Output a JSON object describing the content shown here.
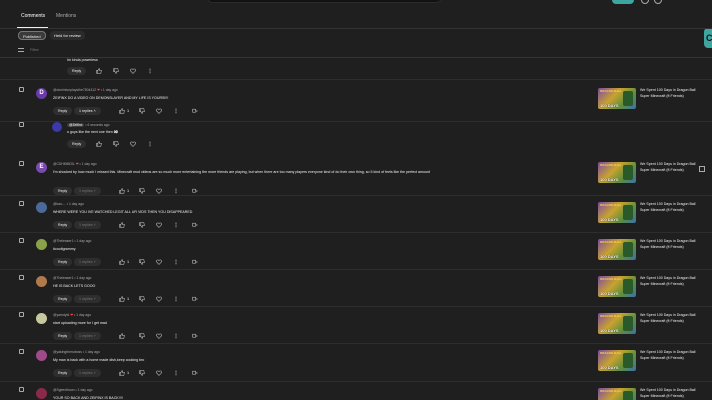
{
  "tabs": [
    {
      "label": "Comments",
      "active": true
    },
    {
      "label": "Mentions",
      "active": false
    }
  ],
  "chips": [
    {
      "label": "Published",
      "active": true
    },
    {
      "label": "Held for review",
      "active": false
    }
  ],
  "filter": {
    "placeholder": "Filter"
  },
  "video": {
    "title": "We Spent 100 Days in Dragon Ball Super Minecraft (ft Friends)",
    "thumb_text": "100 DAYS",
    "thumb_logo": "DRAGON BALL"
  },
  "partial_comment": {
    "text": "Im kinda powerless",
    "reply_label": "Reply"
  },
  "comments": [
    {
      "handle": "@dominionplaysthe7504412",
      "time": "1 day ago",
      "heart": true,
      "text": "ZEIFINX DO A VIDEO ON DEMONSLAYER AND MY LIFE IS YOURS!!!!",
      "reply_label": "Reply",
      "replies_label": "1 replies",
      "replies_expanded": true,
      "likes": "1",
      "avatar_letter": "D",
      "avatar_color": "#6a3aa8"
    },
    {
      "handle": "@CDHMMOIL",
      "time": "1 day ago",
      "heart": true,
      "text": "I'm shocked by how much I missed this. Minecraft mod videos are so much more entertaining the more friends are playing, but when there are too many players everyone kind of do their own thing, so 5 kind of feels like the perfect amount",
      "reply_label": "Reply",
      "replies_label": "1 replies",
      "replies_expanded": false,
      "likes": "1",
      "avatar_letter": "E",
      "avatar_color": "#7a4ab0"
    },
    {
      "handle": "@kao-...",
      "time": "1 day ago",
      "heart": false,
      "text": "WHERE WERE YOU IVE WATCHED LEGIT ALL UR VIDS THEN YOU DISAPPEARED",
      "reply_label": "Reply",
      "replies_label": "1 replies",
      "replies_expanded": false,
      "likes": "",
      "avatar_letter": "",
      "avatar_color": "#4a6a9a"
    },
    {
      "handle": "@Theleaser1",
      "time": "1 day ago",
      "heart": false,
      "text": "#cooltgrammy",
      "reply_label": "Reply",
      "replies_label": "1 replies",
      "replies_expanded": false,
      "likes": "1",
      "avatar_letter": "",
      "avatar_color": "#8aa04a"
    },
    {
      "handle": "@Theleaser1",
      "time": "1 day ago",
      "heart": false,
      "text": "HE IS BACK LETS GOOO",
      "reply_label": "Reply",
      "replies_label": "1 replies",
      "replies_expanded": false,
      "likes": "1",
      "avatar_letter": "",
      "avatar_color": "#b07a4a"
    },
    {
      "handle": "@yarndyld",
      "time": "1 day ago",
      "heart": true,
      "text": "start uploading more for I get mad",
      "reply_label": "Reply",
      "replies_label": "1 replies",
      "replies_expanded": false,
      "likes": "",
      "avatar_letter": "",
      "avatar_color": "#c8c8a0"
    },
    {
      "handle": "@yakingthenoboss",
      "time": "1 day ago",
      "heart": false,
      "text": "My man is back with a home made dish,keep cooking bro",
      "reply_label": "Reply",
      "replies_label": "1 replies",
      "replies_expanded": false,
      "likes": "1",
      "avatar_letter": "",
      "avatar_color": "#a04a8a"
    },
    {
      "handle": "@Sgeexthoon",
      "time": "1 day ago",
      "heart": false,
      "text": "YOUR SO BACK AND ZEIFINX IS BACK!!!!",
      "reply_label": "Reply",
      "replies_label": "1 replies",
      "replies_expanded": false,
      "likes": "",
      "avatar_letter": "",
      "avatar_color": "#8a2a4a"
    }
  ],
  "nested_reply": {
    "handle": "@Zeifinx",
    "time": "6 seconds ago",
    "text": "u guys like the next one then 👀",
    "reply_label": "Reply",
    "avatar_color": "#3a3aa8"
  }
}
